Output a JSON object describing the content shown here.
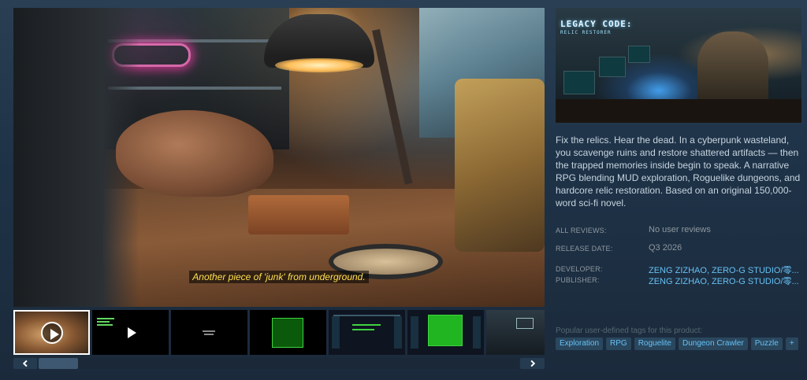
{
  "media": {
    "subtitle": "Another piece of 'junk' from underground."
  },
  "thumbnails": [
    {
      "kind": "video",
      "selected": true
    },
    {
      "kind": "video",
      "selected": false
    },
    {
      "kind": "screenshot",
      "selected": false
    },
    {
      "kind": "screenshot",
      "selected": false
    },
    {
      "kind": "screenshot",
      "selected": false
    },
    {
      "kind": "screenshot",
      "selected": false
    },
    {
      "kind": "screenshot",
      "selected": false
    }
  ],
  "header": {
    "logo_line1": "LEGACY CODE:",
    "logo_line2": "RELIC RESTORER"
  },
  "description": "Fix the relics. Hear the dead. In a cyberpunk wasteland, you scavenge ruins and restore shattered artifacts — then the trapped memories inside begin to speak. A narrative RPG blending MUD exploration, Roguelike dungeons, and hardcore relic restoration. Based on an original 150,000-word sci-fi novel.",
  "info": {
    "reviews_label": "ALL REVIEWS:",
    "reviews_value": "No user reviews",
    "release_label": "RELEASE DATE:",
    "release_value": "Q3 2026",
    "developer_label": "DEVELOPER:",
    "developer_value": "ZENG ZIZHAO, ZERO-G STUDIO/零...",
    "publisher_label": "PUBLISHER:",
    "publisher_value": "ZENG ZIZHAO, ZERO-G STUDIO/零..."
  },
  "tags": {
    "label": "Popular user-defined tags for this product:",
    "items": [
      "Exploration",
      "RPG",
      "Roguelite",
      "Dungeon Crawler",
      "Puzzle",
      "+"
    ]
  },
  "colors": {
    "link": "#66c0f4",
    "tag_bg": "#2a475e",
    "tag_text": "#67c1f5",
    "subtitle": "#ffe14d"
  }
}
